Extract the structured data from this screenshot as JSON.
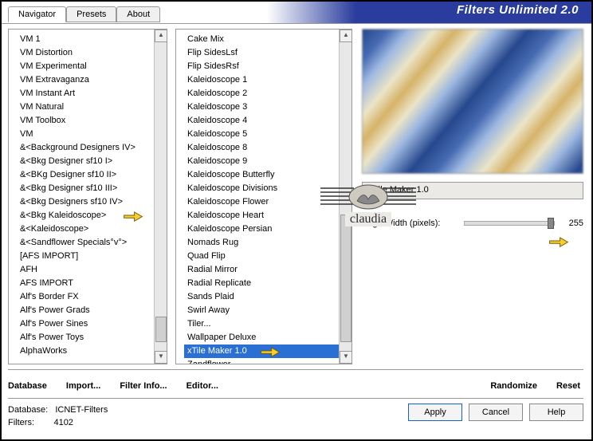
{
  "header": {
    "title": "Filters Unlimited 2.0"
  },
  "tabs": {
    "navigator": "Navigator",
    "presets": "Presets",
    "about": "About"
  },
  "list_categories": [
    "VM 1",
    "VM Distortion",
    "VM Experimental",
    "VM Extravaganza",
    "VM Instant Art",
    "VM Natural",
    "VM Toolbox",
    "VM",
    "&<Background Designers IV>",
    "&<Bkg Designer sf10 I>",
    "&<BKg Designer sf10 II>",
    "&<Bkg Designer sf10 III>",
    "&<Bkg Designers sf10 IV>",
    "&<Bkg Kaleidoscope>",
    "&<Kaleidoscope>",
    "&<Sandflower Specials°v°>",
    "[AFS IMPORT]",
    "AFH",
    "AFS IMPORT",
    "Alf's Border FX",
    "Alf's Power Grads",
    "Alf's Power Sines",
    "Alf's Power Toys",
    "AlphaWorks"
  ],
  "list_filters": [
    "Cake Mix",
    "Flip SidesLsf",
    "Flip SidesRsf",
    "Kaleidoscope 1",
    "Kaleidoscope 2",
    "Kaleidoscope 3",
    "Kaleidoscope 4",
    "Kaleidoscope 5",
    "Kaleidoscope 8",
    "Kaleidoscope 9",
    "Kaleidoscope Butterfly",
    "Kaleidoscope Divisions",
    "Kaleidoscope Flower",
    "Kaleidoscope Heart",
    "Kaleidoscope Persian",
    "Nomads Rug",
    "Quad Flip",
    "Radial Mirror",
    "Radial Replicate",
    "Sands Plaid",
    "Swirl Away",
    "Tiler...",
    "Wallpaper Deluxe",
    "xTile Maker 1.0",
    "Zandflower"
  ],
  "selected_filter_index": 23,
  "preview": {
    "filter_name": "xTile Maker 1.0"
  },
  "params": {
    "edge_width_label": "Edge Width (pixels):",
    "edge_width_value": "255"
  },
  "toolbar": {
    "database": "Database",
    "import": "Import...",
    "filter_info": "Filter Info...",
    "editor": "Editor...",
    "randomize": "Randomize",
    "reset": "Reset"
  },
  "footer": {
    "db_label": "Database:",
    "db_value": "ICNET-Filters",
    "filters_label": "Filters:",
    "filters_value": "4102",
    "apply": "Apply",
    "cancel": "Cancel",
    "help": "Help"
  },
  "watermark": {
    "label": "claudia"
  }
}
